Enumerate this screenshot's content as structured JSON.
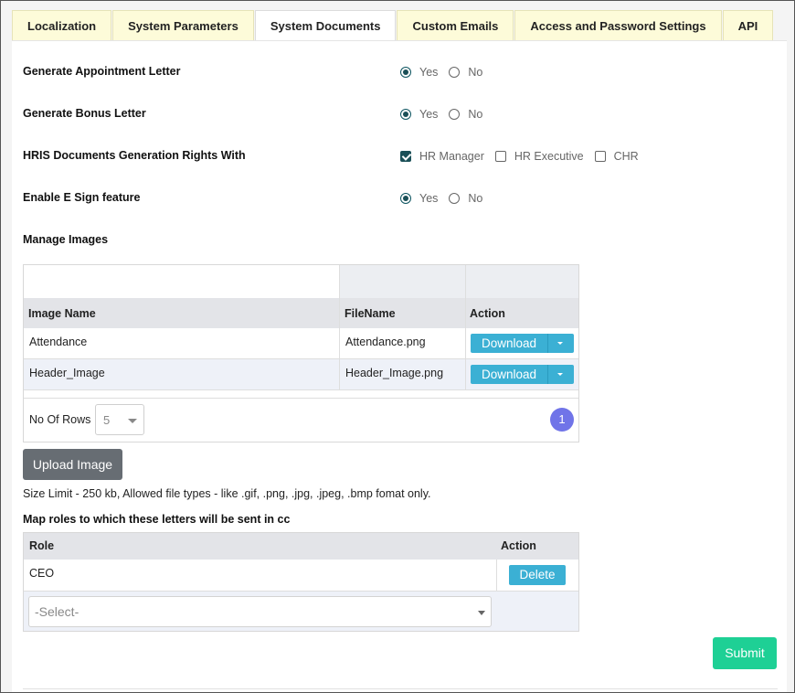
{
  "tabs": [
    {
      "label": "Localization"
    },
    {
      "label": "System Parameters"
    },
    {
      "label": "System Documents"
    },
    {
      "label": "Custom Emails"
    },
    {
      "label": "Access and Password Settings"
    },
    {
      "label": "API"
    }
  ],
  "settings": {
    "appointment": {
      "label": "Generate Appointment Letter",
      "yes": "Yes",
      "no": "No",
      "selected": "Yes"
    },
    "bonus": {
      "label": "Generate Bonus Letter",
      "yes": "Yes",
      "no": "No",
      "selected": "Yes"
    },
    "rights": {
      "label": "HRIS Documents Generation Rights With",
      "opt1": "HR Manager",
      "opt2": "HR Executive",
      "opt3": "CHR",
      "checked": [
        "HR Manager"
      ]
    },
    "esign": {
      "label": "Enable E Sign feature",
      "yes": "Yes",
      "no": "No",
      "selected": "Yes"
    }
  },
  "images": {
    "title": "Manage Images",
    "headers": {
      "name": "Image Name",
      "file": "FileName",
      "action": "Action"
    },
    "rows": [
      {
        "name": "Attendance",
        "file": "Attendance.png",
        "action": "Download"
      },
      {
        "name": "Header_Image",
        "file": "Header_Image.png",
        "action": "Download"
      }
    ],
    "rows_label": "No Of Rows :",
    "rows_value": "5",
    "page": "1",
    "upload_label": "Upload Image",
    "size_note": "Size Limit - 250 kb, Allowed file types - like .gif, .png, .jpg, .jpeg, .bmp fomat only."
  },
  "roles": {
    "title": "Map roles to which these letters will be sent in cc",
    "headers": {
      "role": "Role",
      "action": "Action"
    },
    "rows": [
      {
        "role": "CEO",
        "action": "Delete"
      }
    ],
    "select_placeholder": "-Select-"
  },
  "submit_label": "Submit",
  "colors": {
    "tab_bg": "#fdfbd9",
    "accent_teal": "#1a4f57",
    "button_blue": "#3bb0d4",
    "upload_gray": "#676d73",
    "submit_green": "#1ed095",
    "page_badge": "#7074e8"
  }
}
